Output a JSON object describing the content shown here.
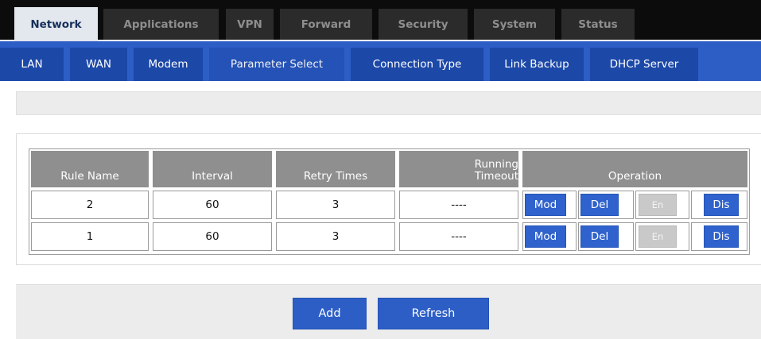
{
  "top_menu": [
    {
      "label": "Network",
      "active": true
    },
    {
      "label": "Applications",
      "active": false
    },
    {
      "label": "VPN",
      "active": false
    },
    {
      "label": "Forward",
      "active": false
    },
    {
      "label": "Security",
      "active": false
    },
    {
      "label": "System",
      "active": false
    },
    {
      "label": "Status",
      "active": false
    }
  ],
  "sub_menu": [
    {
      "label": "LAN",
      "active": false
    },
    {
      "label": "WAN",
      "active": false
    },
    {
      "label": "Modem",
      "active": false
    },
    {
      "label": "Parameter Select",
      "active": true
    },
    {
      "label": "Connection Type",
      "active": false
    },
    {
      "label": "Link Backup",
      "active": false
    },
    {
      "label": "DHCP Server",
      "active": false
    }
  ],
  "table": {
    "headers": {
      "rule_name": "Rule Name",
      "interval": "Interval",
      "retry_times": "Retry Times",
      "running_timeout_line1": "Running",
      "running_timeout_line2": "Timeout",
      "operation": "Operation"
    },
    "rows": [
      {
        "rule_name": "2",
        "interval": "60",
        "retry_times": "3",
        "running_timeout": "----"
      },
      {
        "rule_name": "1",
        "interval": "60",
        "retry_times": "3",
        "running_timeout": "----"
      }
    ],
    "row_buttons": {
      "mod": "Mod",
      "del": "Del",
      "en": "En",
      "dis": "Dis"
    }
  },
  "actions": {
    "add": "Add",
    "refresh": "Refresh"
  },
  "colors": {
    "top_menu_bg": "#0c0c0c",
    "sub_menu_bg": "#2d5ec6",
    "accent_blue": "#2f62cc",
    "header_grey": "#8f8f8f"
  }
}
